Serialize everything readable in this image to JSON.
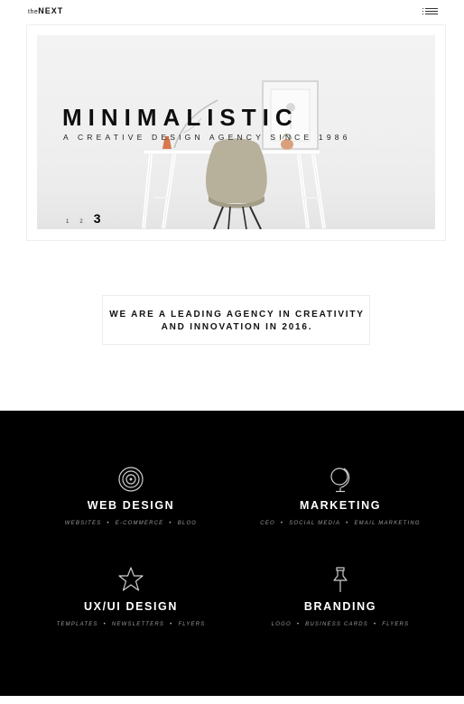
{
  "header": {
    "logo_prefix": "the",
    "logo_name": "NEXT",
    "menu_icon": "hamburger-menu-icon"
  },
  "hero": {
    "title": "MINIMALISTIC",
    "subtitle": "A CREATIVE DESIGN AGENCY SINCE 1986",
    "slides": [
      "1",
      "2",
      "3"
    ],
    "active_slide": "3"
  },
  "intro": {
    "line1": "WE ARE A LEADING AGENCY IN CREATIVITY",
    "line2": "AND INNOVATION IN 2016."
  },
  "services": [
    {
      "icon": "target-icon",
      "title": "WEB DESIGN",
      "tags": [
        "WEBSITES",
        "E-COMMERCE",
        "BLOG"
      ]
    },
    {
      "icon": "globe-icon",
      "title": "MARKETING",
      "tags": [
        "CEO",
        "SOCIAL MEDIA",
        "EMAIL MARKETING"
      ]
    },
    {
      "icon": "star-icon",
      "title": "UX/UI DESIGN",
      "tags": [
        "TEMPLATES",
        "NEWSLETTERS",
        "FLYERS"
      ]
    },
    {
      "icon": "pushpin-icon",
      "title": "BRANDING",
      "tags": [
        "LOGO",
        "BUSINESS CARDS",
        "FLYERS"
      ]
    }
  ],
  "colors": {
    "background": "#ffffff",
    "services_background": "#000000",
    "service_title": "#ffffff",
    "service_tags": "#9a9a9a"
  }
}
